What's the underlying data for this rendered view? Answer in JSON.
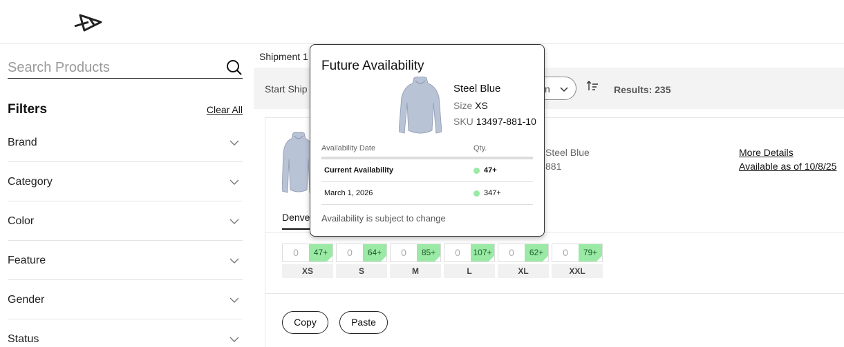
{
  "header": {
    "logo": "brand-logo"
  },
  "search": {
    "placeholder": "Search Products"
  },
  "filters": {
    "title": "Filters",
    "clear_label": "Clear All",
    "items": [
      {
        "label": "Brand"
      },
      {
        "label": "Category"
      },
      {
        "label": "Color"
      },
      {
        "label": "Feature"
      },
      {
        "label": "Gender"
      },
      {
        "label": "Status"
      }
    ]
  },
  "main": {
    "shipment_tab": "Shipment 1",
    "start_ship_label": "Start Ship D",
    "sort_select_value": "n",
    "results_label": "Results: 235"
  },
  "product": {
    "color": "Steel Blue",
    "sku_partial": "881",
    "more_details": "More Details",
    "available_as_of": "Available as of 10/8/25",
    "warehouse_tab": "Denver",
    "sizes": [
      {
        "label": "XS",
        "qty": "0",
        "available": "47+"
      },
      {
        "label": "S",
        "qty": "0",
        "available": "64+"
      },
      {
        "label": "M",
        "qty": "0",
        "available": "85+"
      },
      {
        "label": "L",
        "qty": "0",
        "available": "107+"
      },
      {
        "label": "XL",
        "qty": "0",
        "available": "62+"
      },
      {
        "label": "XXL",
        "qty": "0",
        "available": "79+"
      }
    ],
    "copy_label": "Copy",
    "paste_label": "Paste"
  },
  "popover": {
    "title": "Future Availability",
    "color": "Steel Blue",
    "size_label": "Size",
    "size_value": "XS",
    "sku_label": "SKU",
    "sku_value": "13497-881-10",
    "col_date": "Availability Date",
    "col_qty": "Qty.",
    "rows": [
      {
        "date": "Current Availability",
        "qty": "47+"
      },
      {
        "date": "March 1, 2026",
        "qty": "347+"
      }
    ],
    "note": "Availability is subject to change"
  },
  "colors": {
    "available_green": "#9aeaa5",
    "toolbar_bg": "#f3f3f3"
  }
}
